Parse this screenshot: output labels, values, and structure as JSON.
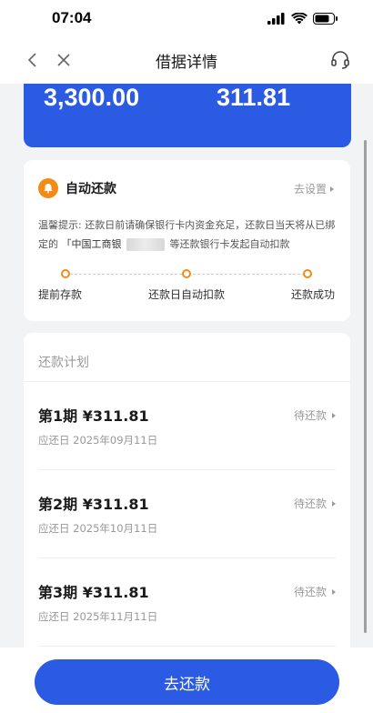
{
  "status_bar": {
    "time": "07:04"
  },
  "nav": {
    "title": "借据详情"
  },
  "summary": {
    "amount_total": "3,300.00",
    "amount_period": "311.81"
  },
  "auto_repay": {
    "title": "自动还款",
    "action": "去设置",
    "tip_prefix": "温馨提示: 还款日前请确保银行卡内资金充足，还款日当天将从已绑定的",
    "bank": "「中国工商银",
    "tip_suffix": "等还款银行卡发起自动扣款",
    "steps": [
      "提前存款",
      "还款日自动扣款",
      "还款成功"
    ]
  },
  "plan": {
    "title": "还款计划",
    "items": [
      {
        "label": "第1期 ¥311.81",
        "status": "待还款",
        "due": "应还日 2025年09月11日"
      },
      {
        "label": "第2期 ¥311.81",
        "status": "待还款",
        "due": "应还日 2025年10月11日"
      },
      {
        "label": "第3期 ¥311.81",
        "status": "待还款",
        "due": "应还日 2025年11月11日"
      }
    ]
  },
  "bottom": {
    "button_label": "去还款"
  },
  "colors": {
    "primary": "#2b5be3",
    "accent": "#f28b17"
  }
}
